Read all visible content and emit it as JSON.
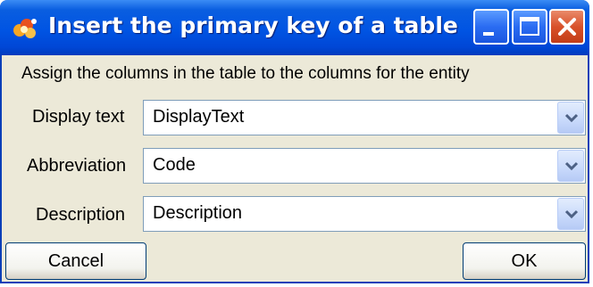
{
  "window": {
    "title": "Insert the primary key of a table",
    "icon": "app-flower-icon"
  },
  "title_buttons": {
    "minimize_icon": "minimize-icon",
    "maximize_icon": "maximize-icon",
    "close_icon": "close-icon"
  },
  "instruction": "Assign the columns in the table to the columns for the entity",
  "fields": [
    {
      "label": "Display text",
      "value": "DisplayText"
    },
    {
      "label": "Abbreviation",
      "value": "Code"
    },
    {
      "label": "Description",
      "value": "Description"
    }
  ],
  "buttons": {
    "cancel_label": "Cancel",
    "ok_label": "OK"
  },
  "colors": {
    "titlebar": "#0054e3",
    "dialog_background": "#ece9d8",
    "close_button": "#d9512a",
    "combo_border": "#7f9db9"
  }
}
